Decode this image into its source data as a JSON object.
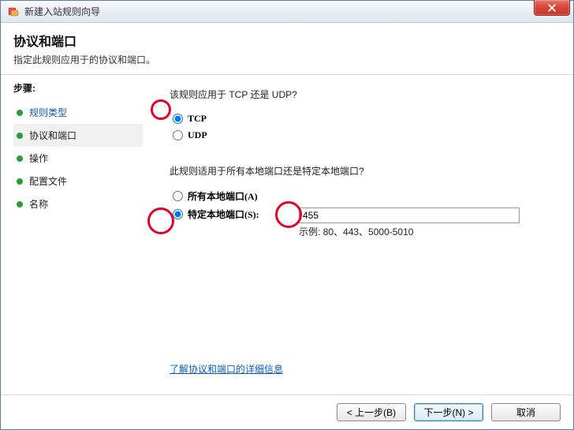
{
  "window": {
    "title": "新建入站规则向导"
  },
  "header": {
    "title": "协议和端口",
    "subtitle": "指定此规则应用于的协议和端口。"
  },
  "sidebar": {
    "steps_label": "步骤:",
    "items": [
      {
        "label": "规则类型",
        "link": true,
        "current": false
      },
      {
        "label": "协议和端口",
        "link": false,
        "current": true
      },
      {
        "label": "操作",
        "link": false,
        "current": false
      },
      {
        "label": "配置文件",
        "link": false,
        "current": false
      },
      {
        "label": "名称",
        "link": false,
        "current": false
      }
    ]
  },
  "main": {
    "q1": "该规则应用于 TCP 还是 UDP?",
    "tcp_label": "TCP",
    "udp_label": "UDP",
    "protocol_selected": "tcp",
    "q2": "此规则适用于所有本地端口还是特定本地端口?",
    "all_ports_label": "所有本地端口(A)",
    "specific_ports_label": "特定本地端口(S):",
    "port_scope_selected": "specific",
    "port_value": "455",
    "example_prefix": "示例:",
    "example_value": "80、443、5000-5010",
    "learn_more": "了解协议和端口的详细信息"
  },
  "footer": {
    "back": "< 上一步(B)",
    "next": "下一步(N) >",
    "cancel": "取消"
  }
}
